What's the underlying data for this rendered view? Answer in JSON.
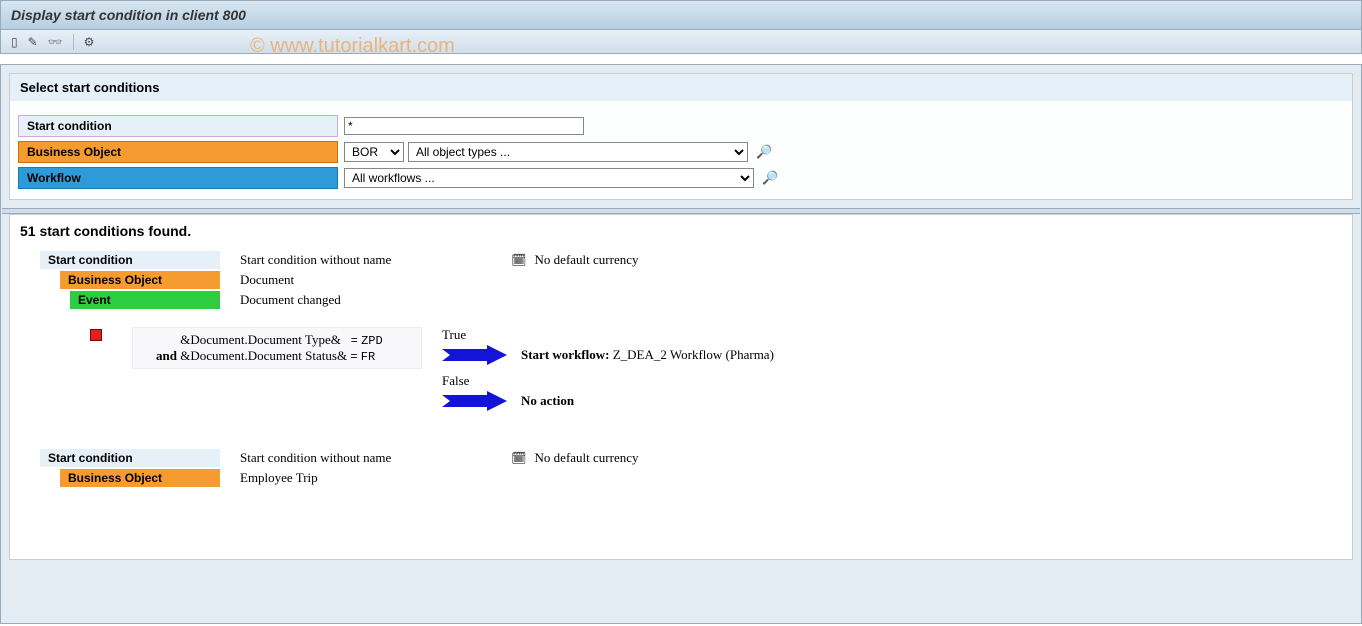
{
  "title": "Display start condition in client 800",
  "watermark": "© www.tutorialkart.com",
  "toolbar": {
    "icons": [
      "new-icon",
      "edit-icon",
      "glasses-icon",
      "settings-icon"
    ]
  },
  "filter": {
    "header": "Select start conditions",
    "start_condition_label": "Start condition",
    "start_condition_value": "*",
    "business_object_label": "Business Object",
    "bor_value": "BOR",
    "object_types_value": "All object types ...",
    "workflow_label": "Workflow",
    "workflow_value": "All workflows ..."
  },
  "results": {
    "count_text": "51 start conditions found.",
    "items": [
      {
        "start_condition_label": "Start condition",
        "start_condition_value": "Start condition without name",
        "currency_text": "No default currency",
        "business_object_label": "Business Object",
        "business_object_value": "Document",
        "event_label": "Event",
        "event_value": "Document changed",
        "logic": {
          "line1_expr": "&Document.Document Type&",
          "line1_op": "=",
          "line1_val": "ZPD",
          "and": "and",
          "line2_expr": "&Document.Document Status&",
          "line2_op": "=",
          "line2_val": "FR",
          "true_label": "True",
          "true_prefix": "Start workflow:",
          "true_text": "Z_DEA_2 Workflow (Pharma)",
          "false_label": "False",
          "false_text": "No action"
        }
      },
      {
        "start_condition_label": "Start condition",
        "start_condition_value": "Start condition without name",
        "currency_text": "No default currency",
        "business_object_label": "Business Object",
        "business_object_value": "Employee Trip"
      }
    ]
  }
}
